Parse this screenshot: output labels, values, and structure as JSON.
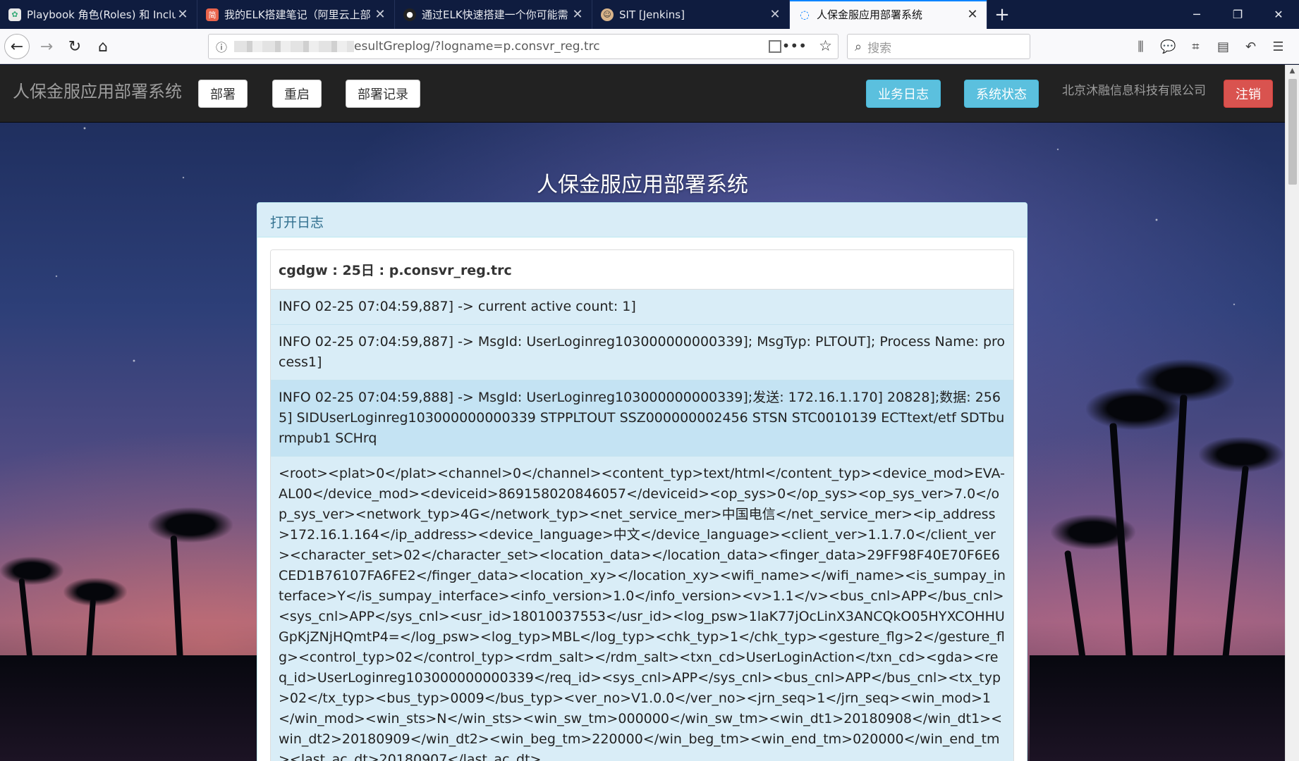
{
  "browser": {
    "tabs": [
      {
        "title": "Playbook 角色(Roles) 和 Inclu",
        "icon": "ansible-icon"
      },
      {
        "title": "我的ELK搭建笔记（阿里云上部",
        "icon": "jianshu-icon"
      },
      {
        "title": "通过ELK快速搭建一个你可能需",
        "icon": "github-icon"
      },
      {
        "title": "SIT [Jenkins]",
        "icon": "jenkins-icon"
      },
      {
        "title": "人保金服应用部署系统",
        "icon": "loading-icon"
      }
    ],
    "url_path": "esultGreplog/?logname=p.consvr_reg.trc",
    "search_placeholder": "搜索"
  },
  "nav": {
    "brand": "人保金服应用部署系统",
    "deploy": "部署",
    "restart": "重启",
    "deploy_log": "部署记录",
    "biz_log": "业务日志",
    "sys_status": "系统状态",
    "company": "北京沐融信息科技有限公司",
    "logout": "注销"
  },
  "main": {
    "title": "人保金服应用部署系统",
    "panel_title": "打开日志",
    "log_header": "cgdgw : 25日 : p.consvr_reg.trc",
    "lines": [
      "INFO 02-25 07:04:59,887] -> current active count: 1]",
      "INFO 02-25 07:04:59,887] -> MsgId: UserLoginreg103000000000339]; MsgTyp: PLTOUT]; Process Name: process1]",
      "INFO 02-25 07:04:59,888] -> MsgId: UserLoginreg103000000000339];发送: 172.16.1.170] 20828];数据: 2565] SIDUserLoginreg103000000000339 STPPLTOUT SSZ000000002456 STSN STC0010139 ECTtext/etf SDTburmpub1 SCHrq",
      "<root><plat>0</plat><channel>0</channel><content_typ>text/html</content_typ><device_mod>EVA-AL00</device_mod><deviceid>869158020846057</deviceid><op_sys>0</op_sys><op_sys_ver>7.0</op_sys_ver><network_typ>4G</network_typ><net_service_mer>中国电信</net_service_mer><ip_address>172.16.1.164</ip_address><device_language>中文</device_language><client_ver>1.1.7.0</client_ver><character_set>02</character_set><location_data></location_data><finger_data>29FF98F40E70F6E6CED1B76107FA6FE2</finger_data><location_xy></location_xy><wifi_name></wifi_name><is_sumpay_interface>Y</is_sumpay_interface><info_version>1.0</info_version><v>1.1</v><bus_cnl>APP</bus_cnl><sys_cnl>APP</sys_cnl><usr_id>18010037553</usr_id><log_psw>1laK77jOcLinX3ANCQkO05HYXCOHHUGpKjZNjHQmtP4=</log_psw><log_typ>MBL</log_typ><chk_typ>1</chk_typ><gesture_flg>2</gesture_flg><control_typ>02</control_typ><rdm_salt></rdm_salt><txn_cd>UserLoginAction</txn_cd><gda><req_id>UserLoginreg103000000000339</req_id><sys_cnl>APP</sys_cnl><bus_cnl>APP</bus_cnl><tx_typ>02</tx_typ><bus_typ>0009</bus_typ><ver_no>V1.0.0</ver_no><jrn_seq>1</jrn_seq><win_mod>1</win_mod><win_sts>N</win_sts><win_sw_tm>000000</win_sw_tm><win_dt1>20180908</win_dt1><win_dt2>20180909</win_dt2><win_beg_tm>220000</win_beg_tm><win_end_tm>020000</win_end_tm><last_ac_dt>20180907</last_ac_dt>"
    ]
  },
  "colors": {
    "navbar_bg": "#222222",
    "info_btn": "#5bc0de",
    "danger_btn": "#d9534f",
    "panel_heading": "#d9edf7",
    "list_item": "#d9edf7"
  }
}
